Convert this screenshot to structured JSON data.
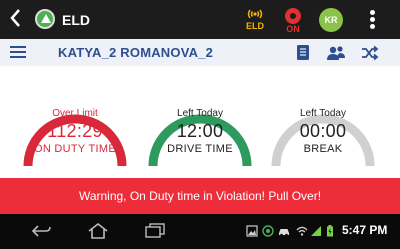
{
  "appbar": {
    "title": "ELD",
    "eld_status_label": "ELD",
    "on_status_label": "ON",
    "avatar_initials": "KR"
  },
  "driver": {
    "name": "KATYA_2 ROMANOVA_2"
  },
  "gauges": [
    {
      "caption": "Over Limit",
      "value": "112:29",
      "label": "ON DUTY TIME",
      "fill": 1.0,
      "color": "#d8283a"
    },
    {
      "caption": "Left Today",
      "value": "12:00",
      "label": "DRIVE TIME",
      "fill": 1.0,
      "color": "#2e9a5e"
    },
    {
      "caption": "Left Today",
      "value": "00:00",
      "label": "BREAK",
      "fill": 0.0,
      "color": "#d0d0d0"
    }
  ],
  "warning": {
    "text": "Warning, On Duty time in Violation! Pull Over!"
  },
  "statusbar": {
    "time": "5:47",
    "period": "PM"
  },
  "colors": {
    "accent": "#2d4f8f",
    "violation": "#ee2d3b",
    "eld_badge": "#f5b400",
    "on_badge": "#e03030",
    "avatar": "#8bc34a"
  }
}
